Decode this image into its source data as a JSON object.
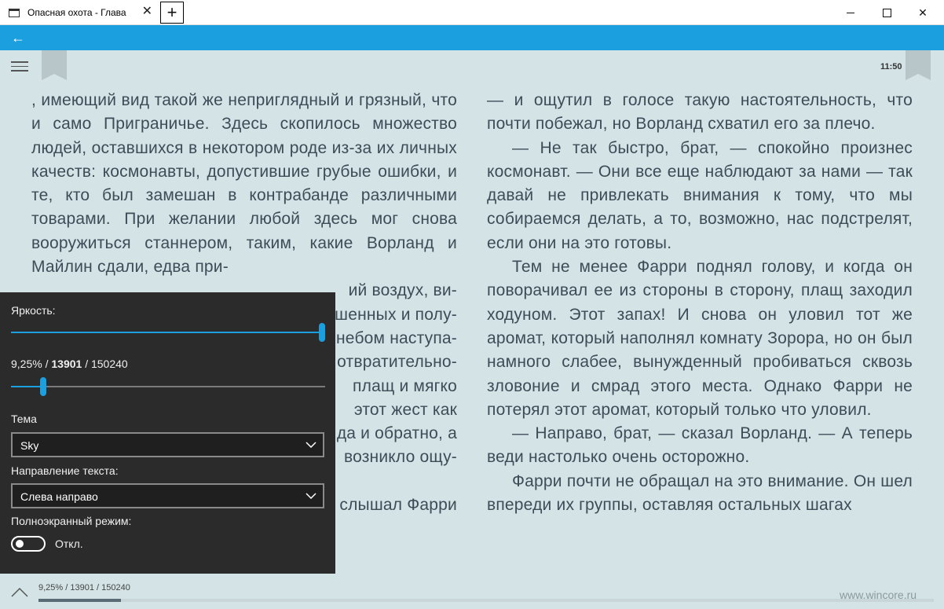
{
  "window": {
    "tab_title": "Опасная охота - Глава",
    "tab_close": "✕",
    "new_tab": "+",
    "close_glyph": "✕"
  },
  "appbar": {
    "back_glyph": "←"
  },
  "reader": {
    "clock": "11:50",
    "left_column": [
      {
        "text": ", имеющий вид такой же неприглядный и гряз­ный, что и само Приграничье. Здесь скопилось множество людей, оставшихся в некотором роде из-за их личных качеств: космонавты, допустив­шие грубые ошибки, и те, кто был замешан в кон­трабанде различными товарами. При желании любой здесь мог снова вооружиться станнером, таким, какие Ворланд и Майлин сдали, едва при-",
        "indent": false
      },
      {
        "text": "ий воздух, ви-",
        "indent": false
      },
      {
        "text": "шенных и полу-",
        "indent": false
      },
      {
        "text": "небом наступа-",
        "indent": false
      },
      {
        "text": "отвратительно-",
        "indent": false
      },
      {
        "text": "плащ и мягко",
        "indent": false
      },
      {
        "text": "этот жест как",
        "indent": false
      },
      {
        "text": "да и обратно, а",
        "indent": false
      },
      {
        "text": "возникло ощу-",
        "indent": false
      },
      {
        "text": "слышал Фарри",
        "indent": false
      }
    ],
    "right_column": [
      {
        "text": "— и ощутил в голосе такую настоятельность, что почти побежал, но Ворланд схватил его за плечо.",
        "indent": false
      },
      {
        "text": "— Не так быстро, брат, — спокойно произнес космонавт. — Они все еще наблюдают за нами — так давай не привлекать внимания к тому, что мы собираемся делать, а то, возможно, нас подстре­лят, если они на это готовы.",
        "indent": true
      },
      {
        "text": "Тем не менее Фарри поднял голову, и когда он поворачивал ее из стороны в сторону, плащ захо­дил ходуном. Этот запах! И снова он уловил тот же аромат, который наполнял комнату Зорора, но он был намного слабее, вынужденный пробивать­ся сквозь зловоние и смрад этого места. Однако Фарри не потерял этот аромат, который только что уловил.",
        "indent": true
      },
      {
        "text": "— Направо, брат, — сказал Ворланд. — А те­перь веди настолько очень осторожно.",
        "indent": true
      },
      {
        "text": "Фарри почти не обращал на это внимание. Он шел впереди их группы, оставляя остальных шагах",
        "indent": true
      }
    ]
  },
  "settings": {
    "brightness_label": "Яркость:",
    "brightness_level": 1.0,
    "progress_percent": "9,25%",
    "progress_sep1": " / ",
    "progress_current": "13901",
    "progress_sep2": " / ",
    "progress_total": "150240",
    "progress_fraction": 0.0925,
    "theme_label": "Тема",
    "theme_value": "Sky",
    "direction_label": "Направление текста:",
    "direction_value": "Слева направо",
    "fullscreen_label": "Полноэкранный режим:",
    "fullscreen_state": "Откл."
  },
  "bottom": {
    "progress_text": "9,25% / 13901 / 150240",
    "fill_fraction": 0.0925,
    "watermark": "www.wincore.ru"
  },
  "colors": {
    "accent": "#1b9fde",
    "page_bg": "#d3e3e6",
    "panel_bg": "#2b2b2b",
    "text": "#3d4c57"
  }
}
